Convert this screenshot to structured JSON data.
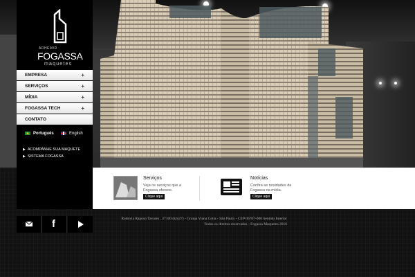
{
  "brand": {
    "small_name": "ADHEMIR",
    "big_name": "FOGASSA",
    "subtitle": "maquetes"
  },
  "menu": [
    {
      "label": "EMPRESA",
      "has_submenu": true
    },
    {
      "label": "SERVIÇOS",
      "has_submenu": true
    },
    {
      "label": "MÍDIA",
      "has_submenu": true
    },
    {
      "label": "FOGASSA TECH",
      "has_submenu": true
    },
    {
      "label": "CONTATO",
      "has_submenu": false
    }
  ],
  "menu_plus": "+",
  "languages": [
    {
      "label": "Português",
      "flag": "flag-brazil"
    },
    {
      "label": "English",
      "flag": "flag-uk"
    }
  ],
  "side_links": [
    {
      "label": "ACOMPANHE SUA MAQUETE"
    },
    {
      "label": "SISTEMA FOGASSA"
    }
  ],
  "features": {
    "services": {
      "title": "Serviços",
      "desc": "Veja os serviços que a Fogassa oferece.",
      "button": "Clique aqui"
    },
    "news": {
      "title": "Notícias",
      "desc": "Confira as novidades da Fogassa na mídia.",
      "button": "Clique aqui"
    }
  },
  "social_icons": [
    "email-icon",
    "facebook-icon",
    "play-icon"
  ],
  "footer": {
    "address": "Rodovia Raposo Tavares , 27100 (km27) - Granja Viana Cotia - São Paulo - CEP 06707-000 Sentido Interior",
    "copyright": "Todos os direitos reservados - Fogassa Maquetes 2016"
  },
  "colors": {
    "background": "#121212",
    "sidebar": "#000000",
    "menu_bg": "#f2f2f2",
    "strip_bg": "#ffffff"
  }
}
